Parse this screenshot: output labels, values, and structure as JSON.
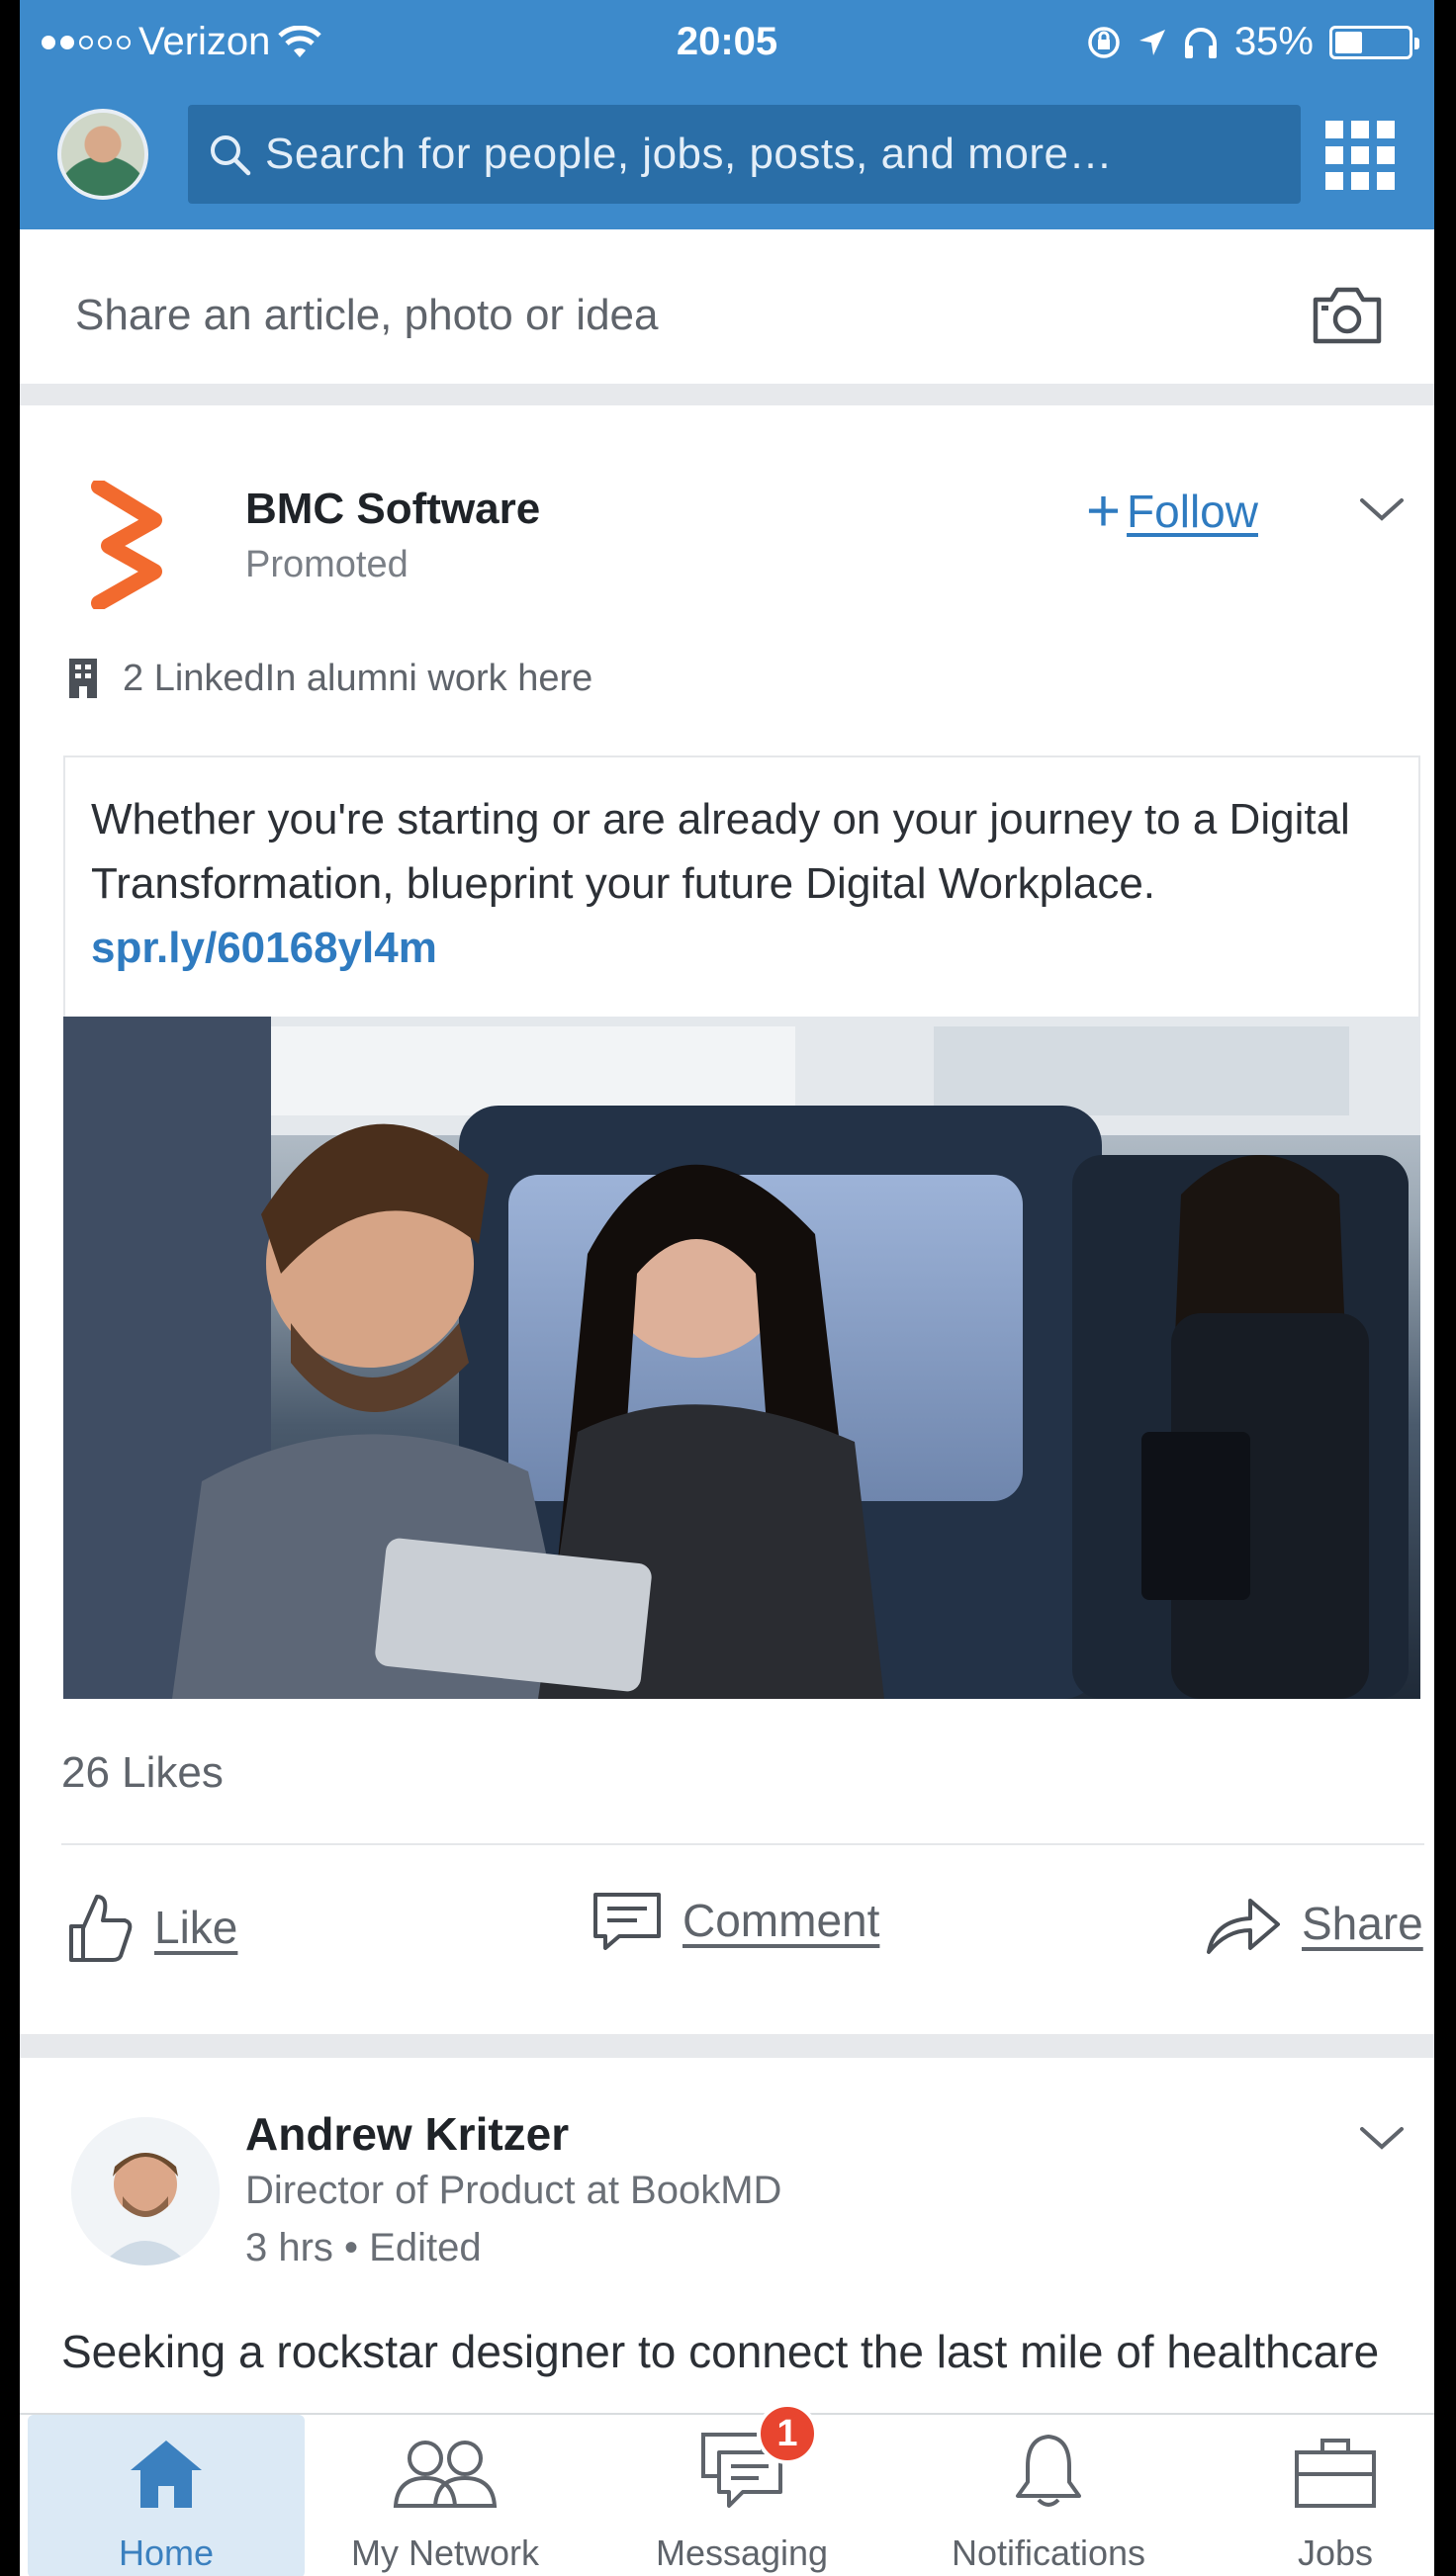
{
  "status_bar": {
    "carrier": "Verizon",
    "time": "20:05",
    "battery_percent": "35%",
    "battery_level": 0.35,
    "signal_bars_filled": 2,
    "signal_bars_total": 5
  },
  "header": {
    "search_placeholder": "Search for people, jobs, posts, and more…"
  },
  "share_bar": {
    "prompt": "Share an article, photo or idea"
  },
  "post": {
    "company": "BMC Software",
    "tag": "Promoted",
    "follow_label": "Follow",
    "follow_plus": "+",
    "alumni": "2 LinkedIn alumni work here",
    "body": "Whether you're starting or are already on your journey to a Digital Transformation, blueprint your future Digital Workplace.",
    "link": "spr.ly/60168yl4m",
    "likes": "26 Likes",
    "actions": {
      "like": "Like",
      "comment": "Comment",
      "share": "Share"
    }
  },
  "post2": {
    "author": "Andrew Kritzer",
    "title": "Director of Product at BookMD",
    "time": "3 hrs • Edited",
    "text": "Seeking a rockstar designer to connect the last mile of healthcare"
  },
  "tabs": [
    {
      "label": "Home",
      "active": true
    },
    {
      "label": "My Network"
    },
    {
      "label": "Messaging",
      "badge": "1"
    },
    {
      "label": "Notifications"
    },
    {
      "label": "Jobs"
    }
  ],
  "colors": {
    "brand_blue": "#3d8acb",
    "link_blue": "#2f7bc0",
    "bmc_orange": "#f26a2e",
    "badge_red": "#e8452f"
  }
}
